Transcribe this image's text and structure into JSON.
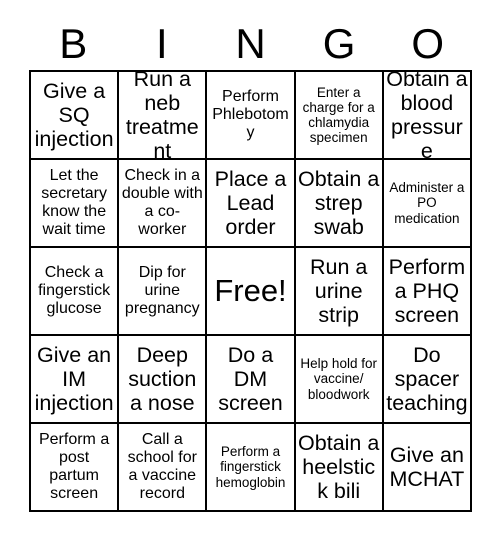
{
  "card": {
    "header_letters": [
      "B",
      "I",
      "N",
      "G",
      "O"
    ],
    "rows": [
      [
        "Give a SQ injection",
        "Run a neb treatment",
        "Perform Phlebotomy",
        "Enter a charge for a chlamydia specimen",
        "Obtain a blood pressure"
      ],
      [
        "Let the secretary know the wait time",
        "Check in a double with a co-worker",
        "Place a Lead order",
        "Obtain a strep swab",
        "Administer a PO medication"
      ],
      [
        "Check a fingerstick glucose",
        "Dip for urine pregnancy",
        "Free!",
        "Run a urine strip",
        "Perform a PHQ screen"
      ],
      [
        "Give an IM injection",
        "Deep suction a nose",
        "Do a DM screen",
        "Help hold for vaccine/ bloodwork",
        "Do spacer teaching"
      ],
      [
        "Perform a post partum screen",
        "Call a school for a vaccine record",
        "Perform a fingerstick hemoglobin",
        "Obtain a heelstick bili",
        "Give an MCHAT"
      ]
    ],
    "text_sizes": [
      [
        "sz-lg",
        "sz-lg",
        "sz-sm",
        "sz-xs",
        "sz-lg"
      ],
      [
        "sz-sm",
        "sz-sm",
        "sz-lg",
        "sz-lg",
        "sz-xs"
      ],
      [
        "sz-sm",
        "sz-sm",
        "sz-xl",
        "sz-lg",
        "sz-lg"
      ],
      [
        "sz-lg",
        "sz-lg",
        "sz-lg",
        "sz-xs",
        "sz-lg"
      ],
      [
        "sz-sm",
        "sz-sm",
        "sz-xs",
        "sz-lg",
        "sz-lg"
      ]
    ],
    "free_space": {
      "row": 2,
      "col": 2,
      "label": "Free!"
    },
    "colors": {
      "border": "#000000",
      "background": "#ffffff",
      "text": "#000000"
    }
  }
}
